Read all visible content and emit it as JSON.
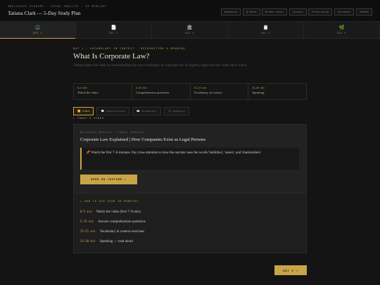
{
  "header": {
    "kicker": "ANGLOSAXE ACADEMY · LEGAL ENGLISH · 30 MIN/DAY",
    "title": "Tatiana Clark — 5-Day Study Plan",
    "pills": [
      "Vocabulary",
      "My Notes",
      "My Work Levels",
      "Glossary",
      "Pronunciation",
      "Dictionary",
      "Podcast"
    ]
  },
  "tabs": [
    {
      "icon": "⚖️",
      "label": "DAY 1"
    },
    {
      "icon": "📄",
      "label": "DAY 2"
    },
    {
      "icon": "🏛",
      "label": "DAY 3"
    },
    {
      "icon": "📋",
      "label": "DAY 4"
    },
    {
      "icon": "🌿",
      "label": "DAY 5"
    }
  ],
  "main": {
    "breadcrumb": "DAY 1 · VOCABULARY IN CONTEXT · RECOGNITION & MEANING",
    "title": "What Is Corporate Law?",
    "subtitle": "Tatiana opens the week by understanding the core vocabulary of corporate law in English, right from the video she'll watch.",
    "stats": [
      {
        "time": "0–5 min",
        "label": "Watch the video"
      },
      {
        "time": "5–15 min",
        "label": "Comprehension questions"
      },
      {
        "time": "15–25 min",
        "label": "Vocabulary in context"
      },
      {
        "time": "25–30 min",
        "label": "Speaking"
      }
    ],
    "subtabs": [
      {
        "icon": "▶️",
        "label": "Video"
      },
      {
        "icon": "💬",
        "label": "Comprehension"
      },
      {
        "icon": "📖",
        "label": "Vocabulary"
      },
      {
        "icon": "🎙",
        "label": "Speaking"
      }
    ],
    "today_label": "▸ TODAY'S VIDEO"
  },
  "video": {
    "meta": "Business Basics · Legal Channel",
    "title": "Corporate Law Explained | How Companies Exist as Legal Persons",
    "tip": "📌 Watch the first 7–8 minutes. Pay close attention to how the narrator uses the words 'liabilities', 'assets', and 'shareholders'.",
    "button": "OPEN ON YOUTUBE ↗"
  },
  "plan": {
    "title": "▸ HOW TO USE YOUR 30 MINUTES",
    "rows": [
      {
        "time": "0–5 min",
        "desc": "Watch the video (first 7–8 min)"
      },
      {
        "time": "5–15 min",
        "desc": "Answer comprehension questions"
      },
      {
        "time": "15–25 min",
        "desc": "Vocabulary in context exercises"
      },
      {
        "time": "25–30 min",
        "desc": "Speaking — read aloud"
      }
    ]
  },
  "next_button": "DAY 2 →",
  "colors": {
    "accent": "#c9a448",
    "background": "#141414",
    "card": "#222222"
  }
}
